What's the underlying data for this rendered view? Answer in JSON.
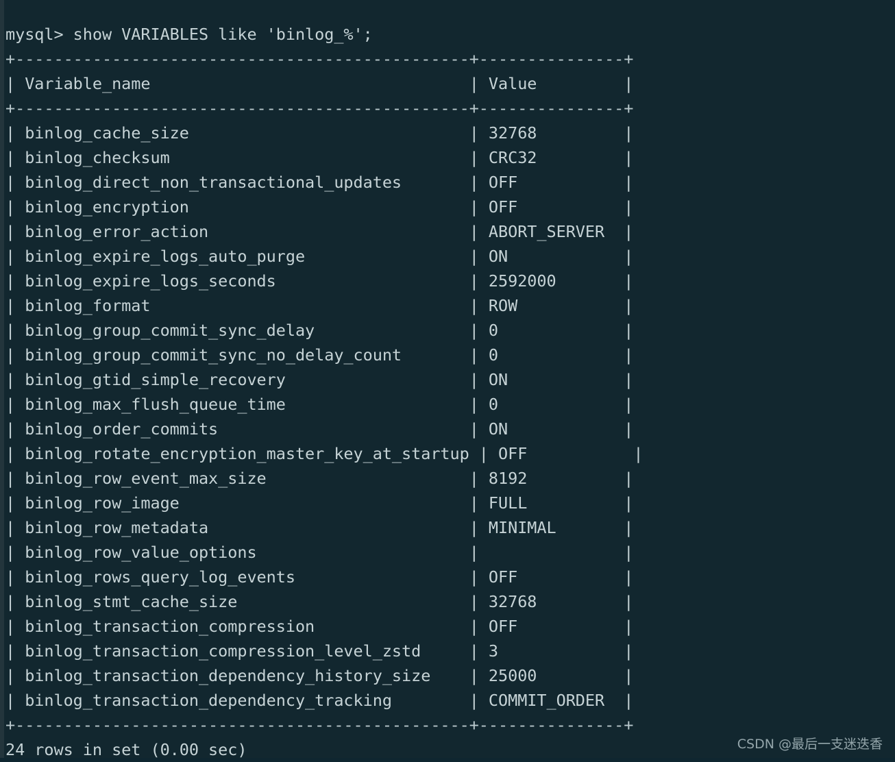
{
  "terminal": {
    "prompt": "mysql> ",
    "command": "show VARIABLES like 'binlog_%';",
    "prompt_line": "mysql> show VARIABLES like 'binlog_%';",
    "status_line": "24 rows in set (0.00 sec)",
    "watermark": "CSDN @最后一支迷迭香",
    "colors": {
      "background": "#12272f",
      "foreground": "#c6d3d6",
      "rule": "#b9c8cc",
      "edge_strip": "#2a3b42",
      "watermark": "#9fb0b5"
    },
    "layout": {
      "name_col_width": 45,
      "value_col_width": 13,
      "font_size_px": 23.5,
      "line_height_px": 36
    }
  },
  "table": {
    "headers": [
      "Variable_name",
      "Value"
    ],
    "row_count": 24,
    "rows": [
      {
        "variable": "binlog_cache_size",
        "value": "32768"
      },
      {
        "variable": "binlog_checksum",
        "value": "CRC32"
      },
      {
        "variable": "binlog_direct_non_transactional_updates",
        "value": "OFF"
      },
      {
        "variable": "binlog_encryption",
        "value": "OFF"
      },
      {
        "variable": "binlog_error_action",
        "value": "ABORT_SERVER"
      },
      {
        "variable": "binlog_expire_logs_auto_purge",
        "value": "ON"
      },
      {
        "variable": "binlog_expire_logs_seconds",
        "value": "2592000"
      },
      {
        "variable": "binlog_format",
        "value": "ROW"
      },
      {
        "variable": "binlog_group_commit_sync_delay",
        "value": "0"
      },
      {
        "variable": "binlog_group_commit_sync_no_delay_count",
        "value": "0"
      },
      {
        "variable": "binlog_gtid_simple_recovery",
        "value": "ON"
      },
      {
        "variable": "binlog_max_flush_queue_time",
        "value": "0"
      },
      {
        "variable": "binlog_order_commits",
        "value": "ON"
      },
      {
        "variable": "binlog_rotate_encryption_master_key_at_startup",
        "value": "OFF"
      },
      {
        "variable": "binlog_row_event_max_size",
        "value": "8192"
      },
      {
        "variable": "binlog_row_image",
        "value": "FULL"
      },
      {
        "variable": "binlog_row_metadata",
        "value": "MINIMAL"
      },
      {
        "variable": "binlog_row_value_options",
        "value": ""
      },
      {
        "variable": "binlog_rows_query_log_events",
        "value": "OFF"
      },
      {
        "variable": "binlog_stmt_cache_size",
        "value": "32768"
      },
      {
        "variable": "binlog_transaction_compression",
        "value": "OFF"
      },
      {
        "variable": "binlog_transaction_compression_level_zstd",
        "value": "3"
      },
      {
        "variable": "binlog_transaction_dependency_history_size",
        "value": "25000"
      },
      {
        "variable": "binlog_transaction_dependency_tracking",
        "value": "COMMIT_ORDER"
      }
    ]
  }
}
